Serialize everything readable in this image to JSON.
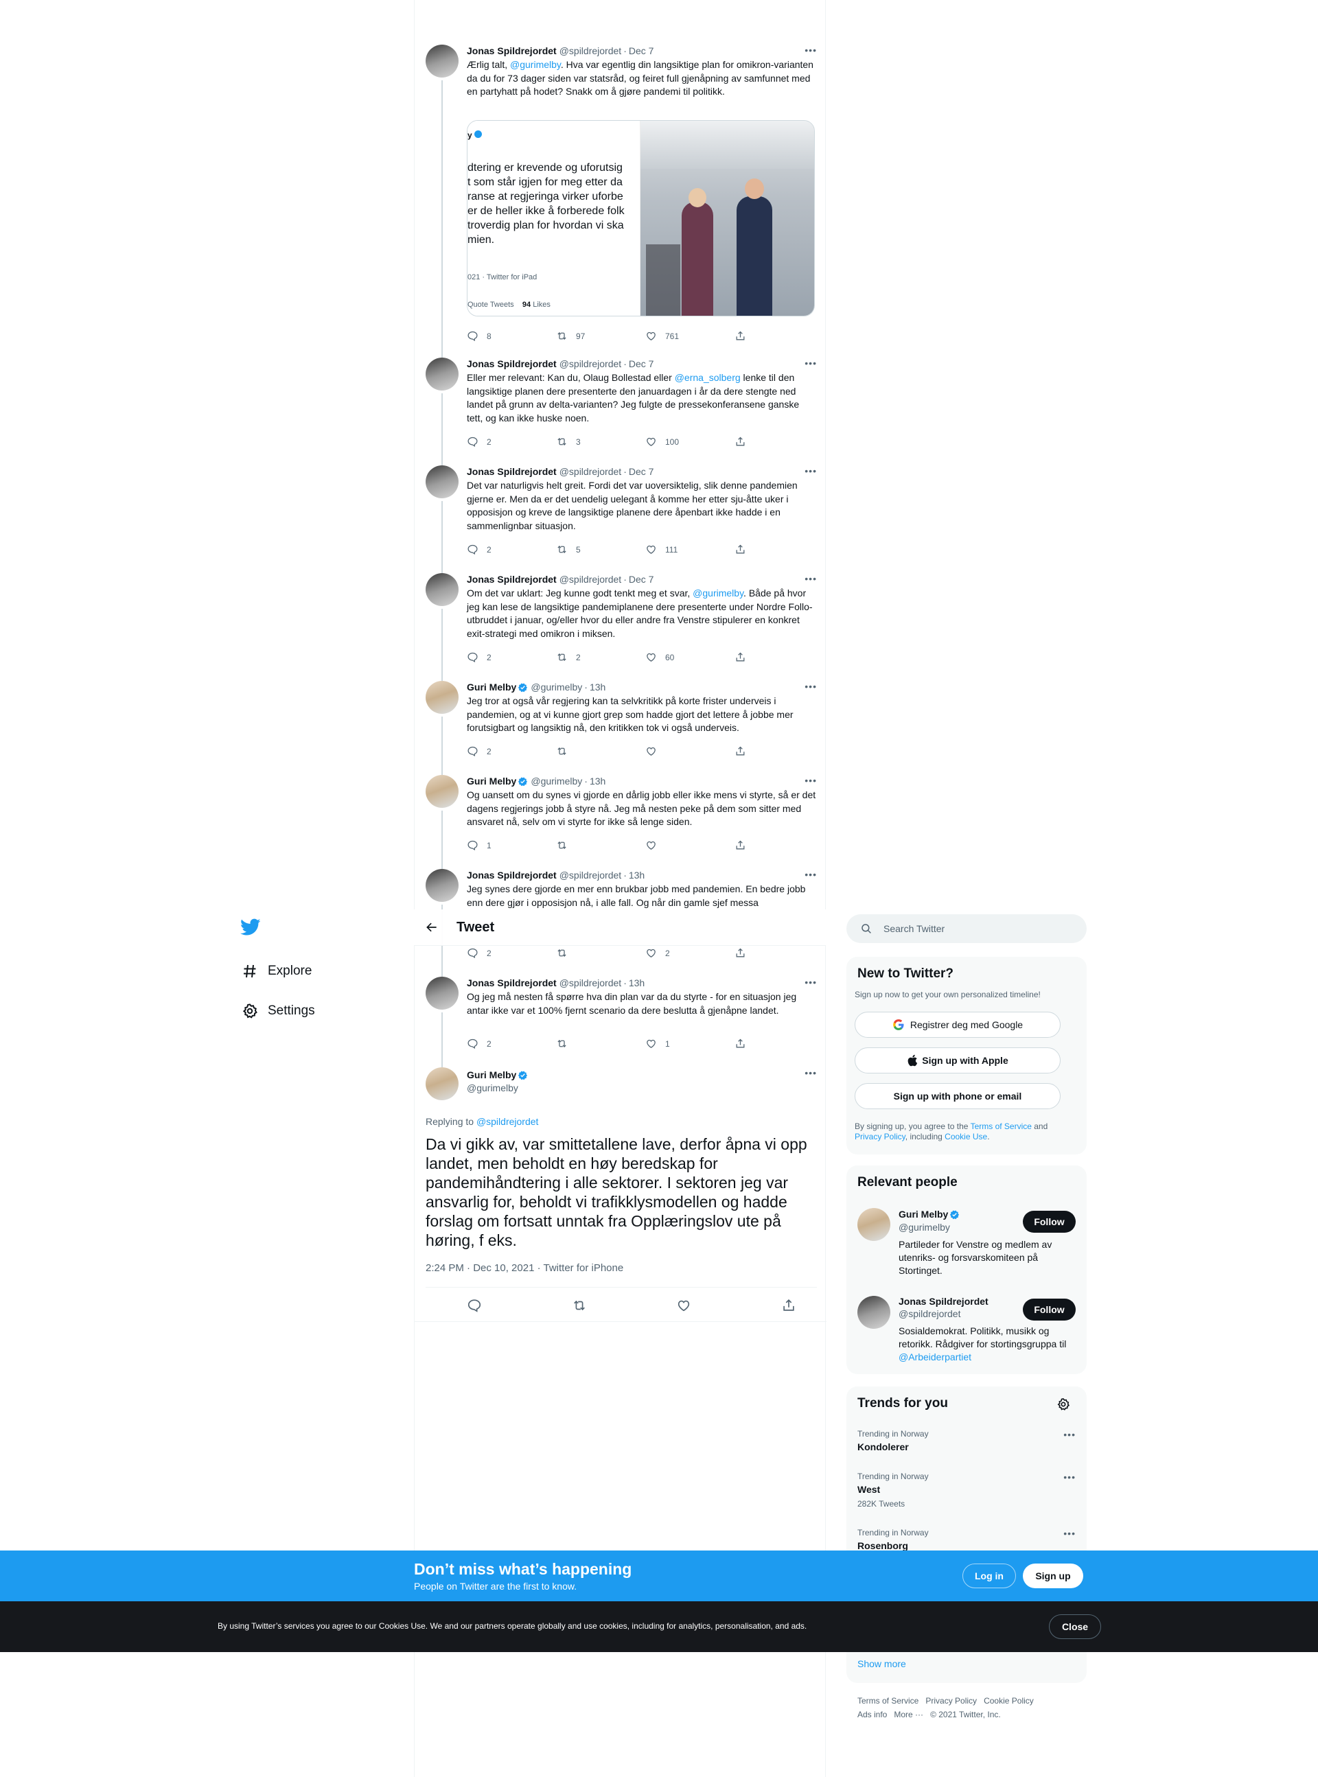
{
  "nav": {
    "explore": "Explore",
    "settings": "Settings"
  },
  "header": {
    "title": "Tweet"
  },
  "tweets": [
    {
      "name": "Jonas Spildrejordet",
      "handle": "@spildrejordet",
      "time": "Dec 7",
      "text_a": "Ærlig talt, ",
      "mention": "@gurimelby",
      "text_b": ". Hva var egentlig din langsiktige plan for omikron-varianten da du for 73 dager siden var statsråd, og feiret full gjenåpning av samfunnet med en partyhatt på hodet? Snakk om å gjøre pandemi til politikk.",
      "replies": "8",
      "retweets": "97",
      "likes": "761",
      "embed": {
        "lines": [
          "dtering er krevende og uforutsig",
          "t som står igjen for meg etter da",
          "ranse at regjeringa virker uforbe",
          "er de heller ikke å forberede folk",
          " troverdig plan for hvordan vi ska",
          "mien."
        ],
        "meta": "021 · Twitter for iPad",
        "quote": "Quote Tweets",
        "likes_count": "94",
        "likes_label": "Likes"
      }
    },
    {
      "name": "Jonas Spildrejordet",
      "handle": "@spildrejordet",
      "time": "Dec 7",
      "text_a": "Eller mer relevant: Kan du, Olaug Bollestad eller ",
      "mention": "@erna_solberg",
      "text_b": " lenke til den langsiktige planen dere presenterte den januardagen i år da dere stengte ned landet på grunn av delta-varianten? Jeg fulgte de pressekonferansene ganske tett, og kan ikke huske noen.",
      "replies": "2",
      "retweets": "3",
      "likes": "100"
    },
    {
      "name": "Jonas Spildrejordet",
      "handle": "@spildrejordet",
      "time": "Dec 7",
      "text_a": "Det var naturligvis helt greit. Fordi det var uoversiktelig, slik denne pandemien gjerne er. Men da er det uendelig uelegant å komme her etter sju-åtte uker i opposisjon og kreve de langsiktige planene dere åpenbart ikke hadde i en sammenlignbar situasjon.",
      "mention": "",
      "text_b": "",
      "replies": "2",
      "retweets": "5",
      "likes": "111"
    },
    {
      "name": "Jonas Spildrejordet",
      "handle": "@spildrejordet",
      "time": "Dec 7",
      "text_a": "Om det var uklart: Jeg kunne godt tenkt meg et svar, ",
      "mention": "@gurimelby",
      "text_b": ". Både på hvor jeg kan lese de langsiktige pandemiplanene dere presenterte under Nordre Follo-utbruddet i januar, og/eller hvor du eller andre fra Venstre stipulerer en konkret exit-strategi med omikron i miksen.",
      "replies": "2",
      "retweets": "2",
      "likes": "60"
    },
    {
      "name": "Guri Melby",
      "handle": "@gurimelby",
      "time": "13h",
      "text_a": "Jeg tror at også vår regjering kan ta selvkritikk på korte frister underveis i pandemien, og at vi kunne gjort grep som hadde gjort det lettere å jobbe mer forutsigbart og langsiktig nå, den kritikken tok vi også underveis.",
      "mention": "",
      "text_b": "",
      "replies": "2",
      "retweets": "",
      "likes": ""
    },
    {
      "name": "Guri Melby",
      "handle": "@gurimelby",
      "time": "13h",
      "text_a": "Og uansett om du synes vi gjorde en dårlig jobb eller ikke mens vi styrte, så er det dagens regjerings jobb å styre nå. Jeg må nesten peke på dem som sitter med ansvaret nå, selv om vi styrte for ikke så lenge siden.",
      "mention": "",
      "text_b": "",
      "replies": "1",
      "retweets": "",
      "likes": ""
    },
    {
      "name": "Jonas Spildrejordet",
      "handle": "@spildrejordet",
      "time": "13h",
      "text_a": "Jeg synes dere gjorde en mer enn brukbar jobb med pandemien. En bedre jobb enn dere gjør i opposisjon nå, i alle fall. Og når din gamle sjef messa",
      "mention": "",
      "text_b": "",
      "replies": "2",
      "retweets": "",
      "likes": "2"
    },
    {
      "name": "Jonas Spildrejordet",
      "handle": "@spildrejordet",
      "time": "13h",
      "text_a": "Og jeg må nesten få spørre hva din plan var da du styrte - for en situasjon jeg antar ikke var et 100% fjernt scenario da dere beslutta å gjenåpne landet.",
      "mention": "",
      "text_b": "",
      "replies": "2",
      "retweets": "",
      "likes": "1"
    }
  ],
  "main_tweet": {
    "name": "Guri Melby",
    "handle": "@gurimelby",
    "replying_label": "Replying to ",
    "replying_to": "@spildrejordet",
    "text": "Da vi gikk av, var smittetallene lave, derfor åpna vi opp landet, men beholdt en høy beredskap for pandemihåndtering i alle sektorer. I sektoren jeg var ansvarlig for, beholdt vi trafikklysmodellen og hadde forslag om fortsatt unntak fra Opplæringslov ute på høring, f eks.",
    "timestamp": "2:24 PM · Dec 10, 2021 · Twitter for iPhone"
  },
  "search": {
    "placeholder": "Search Twitter"
  },
  "new_to_twitter": {
    "title": "New to Twitter?",
    "subtitle": "Sign up now to get your own personalized timeline!",
    "google": "Registrer deg med Google",
    "apple": "Sign up with Apple",
    "phone": "Sign up with phone or email",
    "legal_a": "By signing up, you agree to the ",
    "terms": "Terms of Service",
    "legal_b": " and ",
    "privacy": "Privacy Policy",
    "legal_c": ", including ",
    "cookie": "Cookie Use",
    "legal_d": "."
  },
  "relevant": {
    "title": "Relevant people",
    "people": [
      {
        "name": "Guri Melby",
        "handle": "@gurimelby",
        "bio": "Partileder for Venstre og medlem av utenriks- og forsvarskomiteen på Stortinget.",
        "follow": "Follow"
      },
      {
        "name": "Jonas Spildrejordet",
        "handle": "@spildrejordet",
        "bio_a": "Sosialdemokrat. Politikk, musikk og retorikk. Rådgiver for stortingsgruppa til ",
        "bio_link": "@Arbeiderpartiet",
        "follow": "Follow"
      }
    ]
  },
  "trends": {
    "title": "Trends for you",
    "items": [
      {
        "context": "Trending in Norway",
        "topic": "Kondolerer",
        "count": ""
      },
      {
        "context": "Trending in Norway",
        "topic": "West",
        "count": "282K Tweets"
      },
      {
        "context": "Trending in Norway",
        "topic": "Rosenborg",
        "count": ""
      }
    ],
    "show_more": "Show more"
  },
  "footer": {
    "links": [
      "Terms of Service",
      "Privacy Policy",
      "Cookie Policy",
      "Ads info",
      "More ···"
    ],
    "copyright": "© 2021 Twitter, Inc."
  },
  "banner": {
    "title": "Don’t miss what’s happening",
    "subtitle": "People on Twitter are the first to know.",
    "login": "Log in",
    "signup": "Sign up"
  },
  "cookie_bar": {
    "text": "By using Twitter’s services you agree to our Cookies Use. We and our partners operate globally and use cookies, including for analytics, personalisation, and ads.",
    "close": "Close"
  },
  "colors": {
    "accent": "#1d9bf0",
    "text": "#0f1419",
    "muted": "#536471",
    "dark": "#16181c"
  },
  "icons": [
    "twitter-logo-icon",
    "hashtag-icon",
    "gear-icon",
    "back-arrow-icon",
    "reply-icon",
    "retweet-icon",
    "like-icon",
    "share-icon",
    "verified-icon",
    "search-icon",
    "google-icon",
    "apple-icon",
    "more-icon"
  ]
}
